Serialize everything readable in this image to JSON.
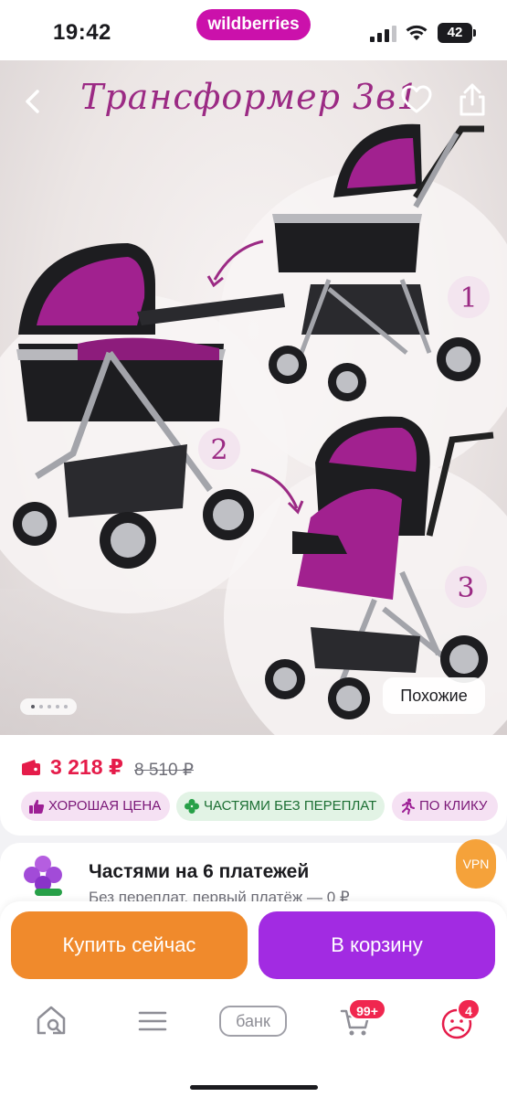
{
  "status_bar": {
    "time": "19:42",
    "app_pill": "wildberries",
    "battery": "42"
  },
  "product_image": {
    "title": "Трансформер 3в1",
    "step_labels": [
      "1",
      "2",
      "3"
    ],
    "similar_label": "Похожие",
    "image_count": 5,
    "active_image": 1
  },
  "price": {
    "current": "3 218 ₽",
    "old": "8 510 ₽",
    "badges": [
      {
        "label": "ХОРОШАЯ ЦЕНА",
        "icon": "thumbs-up-icon"
      },
      {
        "label": "ЧАСТЯМИ БЕЗ ПЕРЕПЛАТ",
        "icon": "clover-icon"
      },
      {
        "label": "ПО КЛИКУ",
        "icon": "running-icon"
      }
    ]
  },
  "installment": {
    "title": "Частями на 6 платежей",
    "subtitle": "Без переплат, первый платёж — 0 ₽",
    "vpn_label": "VPN"
  },
  "actions": {
    "buy_now": "Купить сейчас",
    "add_to_cart": "В корзину"
  },
  "bottom_nav": {
    "bank_label": "банк",
    "cart_badge": "99+",
    "profile_badge": "4",
    "items": [
      "home-search-icon",
      "catalog-icon",
      "bank-icon",
      "cart-icon",
      "profile-icon"
    ]
  },
  "colors": {
    "brand": "#cb11ab",
    "price": "#e51c4a",
    "buy_now": "#f08a2c",
    "add_to_cart": "#a22be2",
    "badge": "#f0274f"
  }
}
